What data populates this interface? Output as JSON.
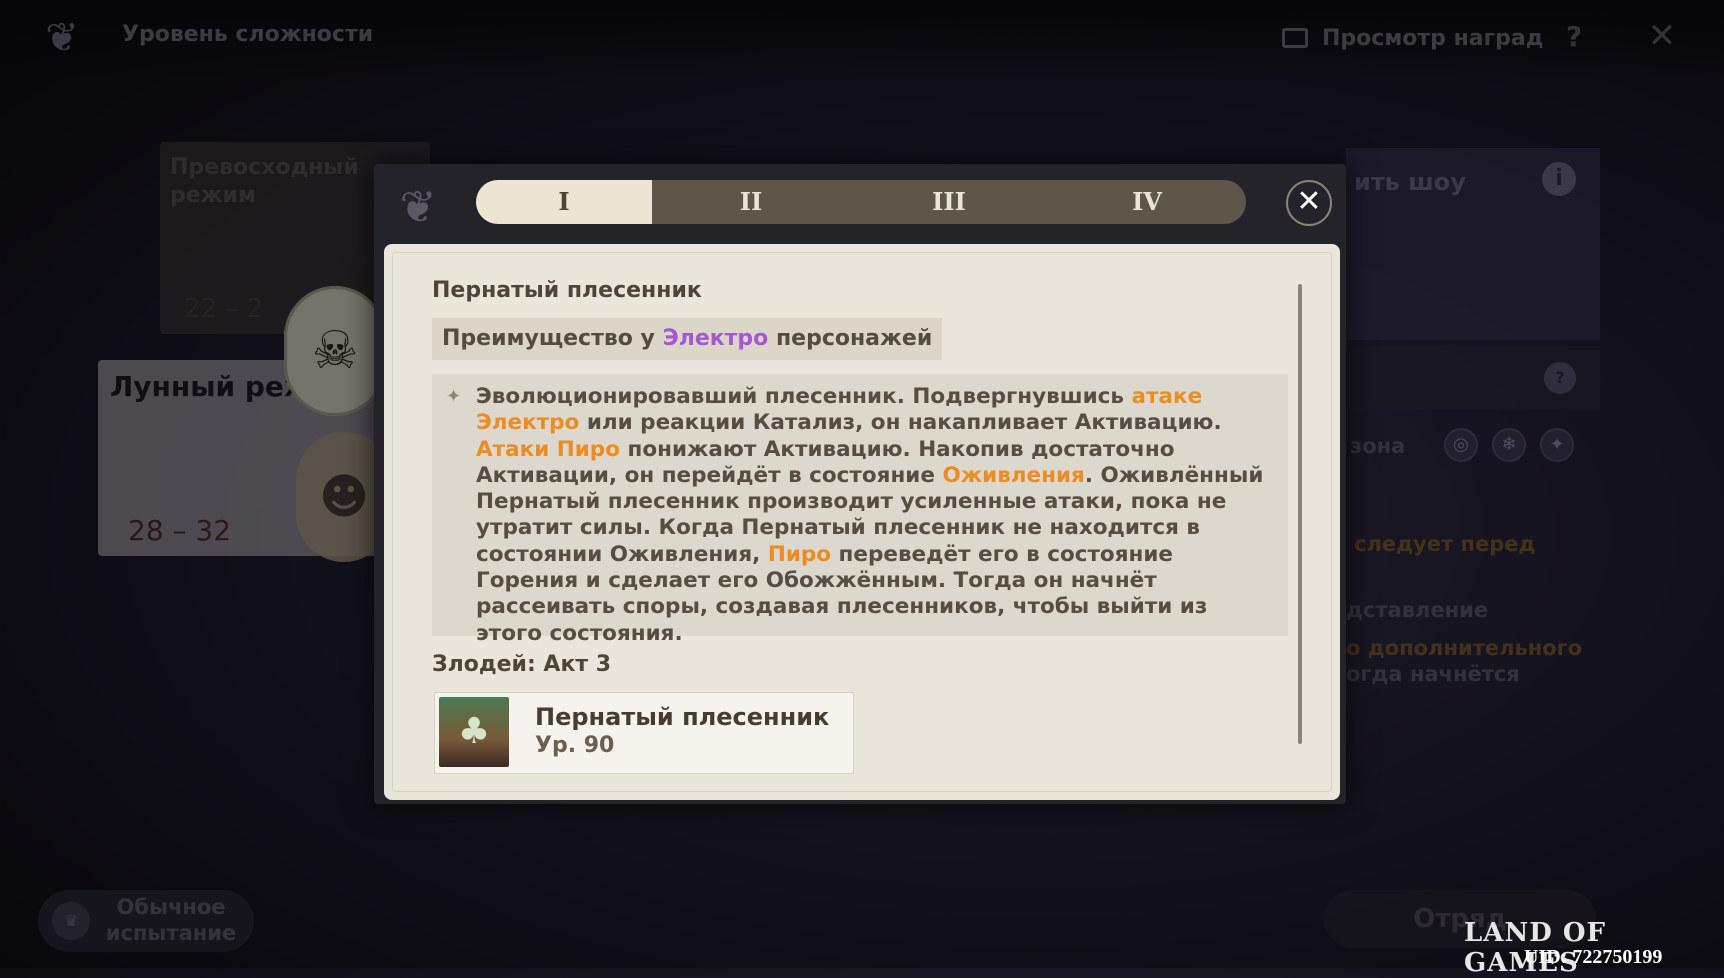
{
  "header": {
    "title": "Уровень сложности",
    "rewards_label": "Просмотр наград",
    "help_label": "?",
    "close_label": "✕"
  },
  "background": {
    "superior_mode": {
      "title": "Превосходный режим",
      "range": "22 – 2"
    },
    "lunar_mode": {
      "title": "Лунный режим",
      "range": "28 – 32"
    },
    "right_panel_title": "ить шоу",
    "side_texts": [
      "зона",
      "следует перед",
      "дставление",
      "о дополнительного",
      "огда начнётся"
    ],
    "normal_button": "Обычное испытание",
    "team_button": "Отряд"
  },
  "modal": {
    "tabs": [
      "I",
      "II",
      "III",
      "IV"
    ],
    "active_tab": 0,
    "close_label": "✕",
    "enemy_name": "Пернатый плесенник",
    "advantage": {
      "prefix": "Преимущество у ",
      "element": "Электро",
      "suffix": " персонажей"
    },
    "description": {
      "p1": "Эволюционировавший плесенник. Подвергнувшись ",
      "h1": "атаке Электро",
      "p2": " или реакции Катализ, он накапливает Активацию. ",
      "h2": "Атаки Пиро",
      "p3": " понижают Активацию. Накопив достаточно Активации, он перейдёт в состояние ",
      "h3": "Оживления",
      "p4": ". Оживлённый Пернатый плесенник производит усиленные атаки, пока не утратит силы. Когда Пернатый плесенник не находится в состоянии Оживления, ",
      "h4": "Пиро",
      "p5": " переведёт его в состояние Горения и сделает его Обожжённым. Тогда он начнёт рассеивать споры, создавая плесенников, чтобы выйти из этого состояния."
    },
    "villains_title": "Злодей: Акт 3",
    "boss": {
      "name": "Пернатый плесенник",
      "level": "Ур. 90"
    }
  },
  "watermark": {
    "brand": "LAND OF GAMES",
    "uid": "UID: 722750199"
  },
  "colors": {
    "electro": "#a458d4",
    "highlight": "#ec8d24",
    "panel": "#ebe6dc"
  }
}
